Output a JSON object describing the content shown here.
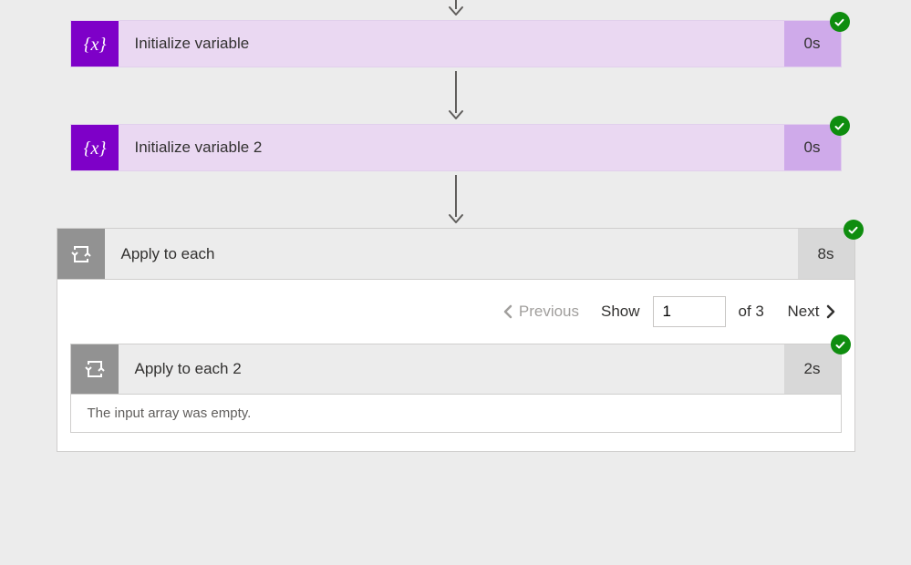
{
  "arrow_partial_height": 22,
  "arrow_full_height": 40,
  "actions": {
    "var1": {
      "title": "Initialize variable",
      "duration": "0s",
      "icon": "variable-icon"
    },
    "var2": {
      "title": "Initialize variable 2",
      "duration": "0s",
      "icon": "variable-icon"
    },
    "loop1": {
      "title": "Apply to each",
      "duration": "8s",
      "icon": "loop-icon",
      "pager": {
        "previous_label": "Previous",
        "show_label": "Show",
        "page_value": "1",
        "of_label": "of 3",
        "next_label": "Next"
      },
      "inner": {
        "title": "Apply to each 2",
        "duration": "2s",
        "icon": "loop-icon",
        "message": "The input array was empty."
      }
    }
  },
  "colors": {
    "variable_icon_bg": "#7e00c8",
    "variable_card_bg": "#ead8f2",
    "loop_icon_bg": "#929292",
    "success_badge": "#0f8d0f"
  }
}
